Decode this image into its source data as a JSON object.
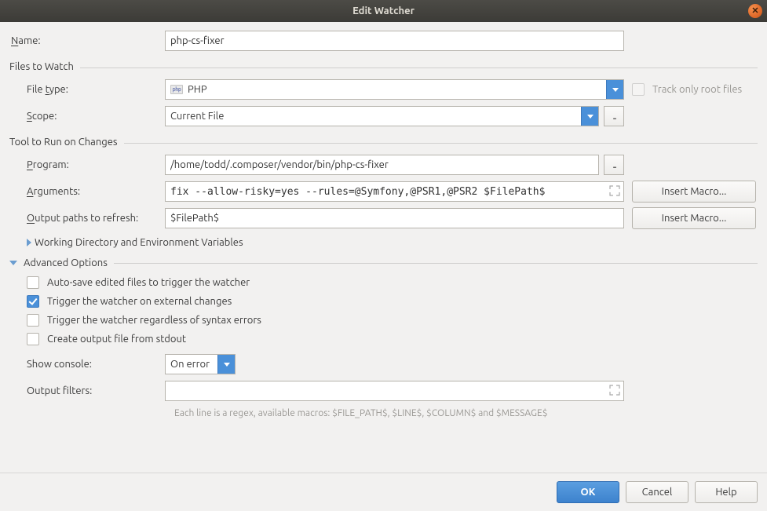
{
  "titlebar": {
    "title": "Edit Watcher"
  },
  "labels": {
    "name": "ame:",
    "file_type": "File ",
    "file_type2": "ype:",
    "scope": "cope:",
    "program": "rogram:",
    "arguments": "rguments:",
    "output_paths": "utput paths to refresh:",
    "show_console": "Show console:",
    "output_filters": "Output filters:"
  },
  "sections": {
    "files_to_watch": "Files to Watch",
    "tool_to_run": "Tool to Run on Changes",
    "working_dir": "Working Directory and Environment Variables",
    "advanced": "Advanced Options"
  },
  "values": {
    "name": "php-cs-fixer",
    "file_type": "PHP",
    "scope": "Current File",
    "program": "/home/todd/.composer/vendor/bin/php-cs-fixer",
    "arguments": "fix --allow-risky=yes --rules=@Symfony,@PSR1,@PSR2 $FilePath$",
    "output_paths": "$FilePath$",
    "show_console": "On error",
    "output_filters": ""
  },
  "checkboxes": {
    "track_root": {
      "label": "Track only root files",
      "checked": false,
      "disabled": true
    },
    "auto_save": {
      "label": "Auto-save edited files to trigger the watcher",
      "checked": false
    },
    "external": {
      "label": "Trigger the watcher on external changes",
      "checked": true
    },
    "syntax": {
      "label": "Trigger the watcher regardless of syntax errors",
      "checked": false
    },
    "stdout": {
      "label": "Create output file from stdout",
      "checked": false
    }
  },
  "buttons": {
    "insert_macro": "Insert Macro...",
    "ok": "OK",
    "cancel": "Cancel",
    "help": "Help"
  },
  "hint": "Each line is a regex, available macros: $FILE_PATH$, $LINE$, $COLUMN$ and $MESSAGE$"
}
